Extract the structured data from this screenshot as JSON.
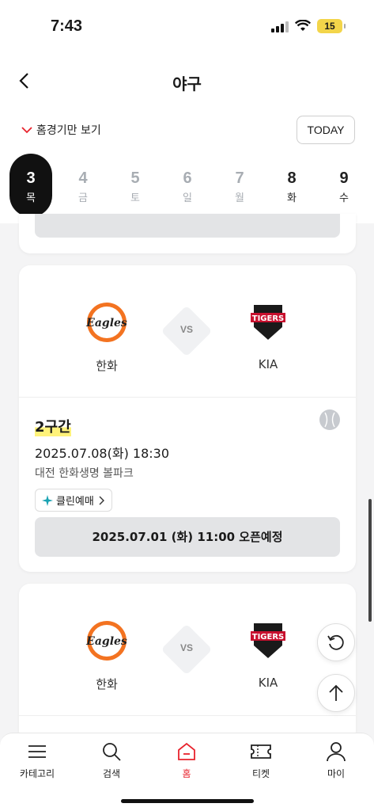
{
  "status_bar": {
    "time": "7:43",
    "battery": "15"
  },
  "header": {
    "title": "야구"
  },
  "filter": {
    "home_only_label": "홈경기만 보기",
    "today_label": "TODAY"
  },
  "dates": [
    {
      "num": "3",
      "dow": "목",
      "state": "selected"
    },
    {
      "num": "4",
      "dow": "금",
      "state": "grey"
    },
    {
      "num": "5",
      "dow": "토",
      "state": "grey"
    },
    {
      "num": "6",
      "dow": "일",
      "state": "grey"
    },
    {
      "num": "7",
      "dow": "월",
      "state": "grey"
    },
    {
      "num": "8",
      "dow": "화",
      "state": "dark"
    },
    {
      "num": "9",
      "dow": "수",
      "state": "dark"
    }
  ],
  "match": {
    "home_team": "한화",
    "away_team": "KIA",
    "vs": "VS",
    "round": "2구간",
    "datetime": "2025.07.08(화) 18:30",
    "venue": "대전 한화생명 볼파크",
    "clean_ticket": "클린예매",
    "open_schedule": "2025.07.01 (화) 11:00 오픈예정"
  },
  "match2": {
    "home_team": "한화",
    "away_team": "KIA",
    "vs": "VS"
  },
  "logos": {
    "home_text": "Eagles",
    "away_text": "TIGERS"
  },
  "nav": {
    "category": "카테고리",
    "search": "검색",
    "home": "홈",
    "ticket": "티켓",
    "my": "마이"
  },
  "colors": {
    "accent": "#e8232d",
    "highlight": "#fff27a",
    "eagles": "#f37321",
    "tigers": "#c8102e"
  }
}
